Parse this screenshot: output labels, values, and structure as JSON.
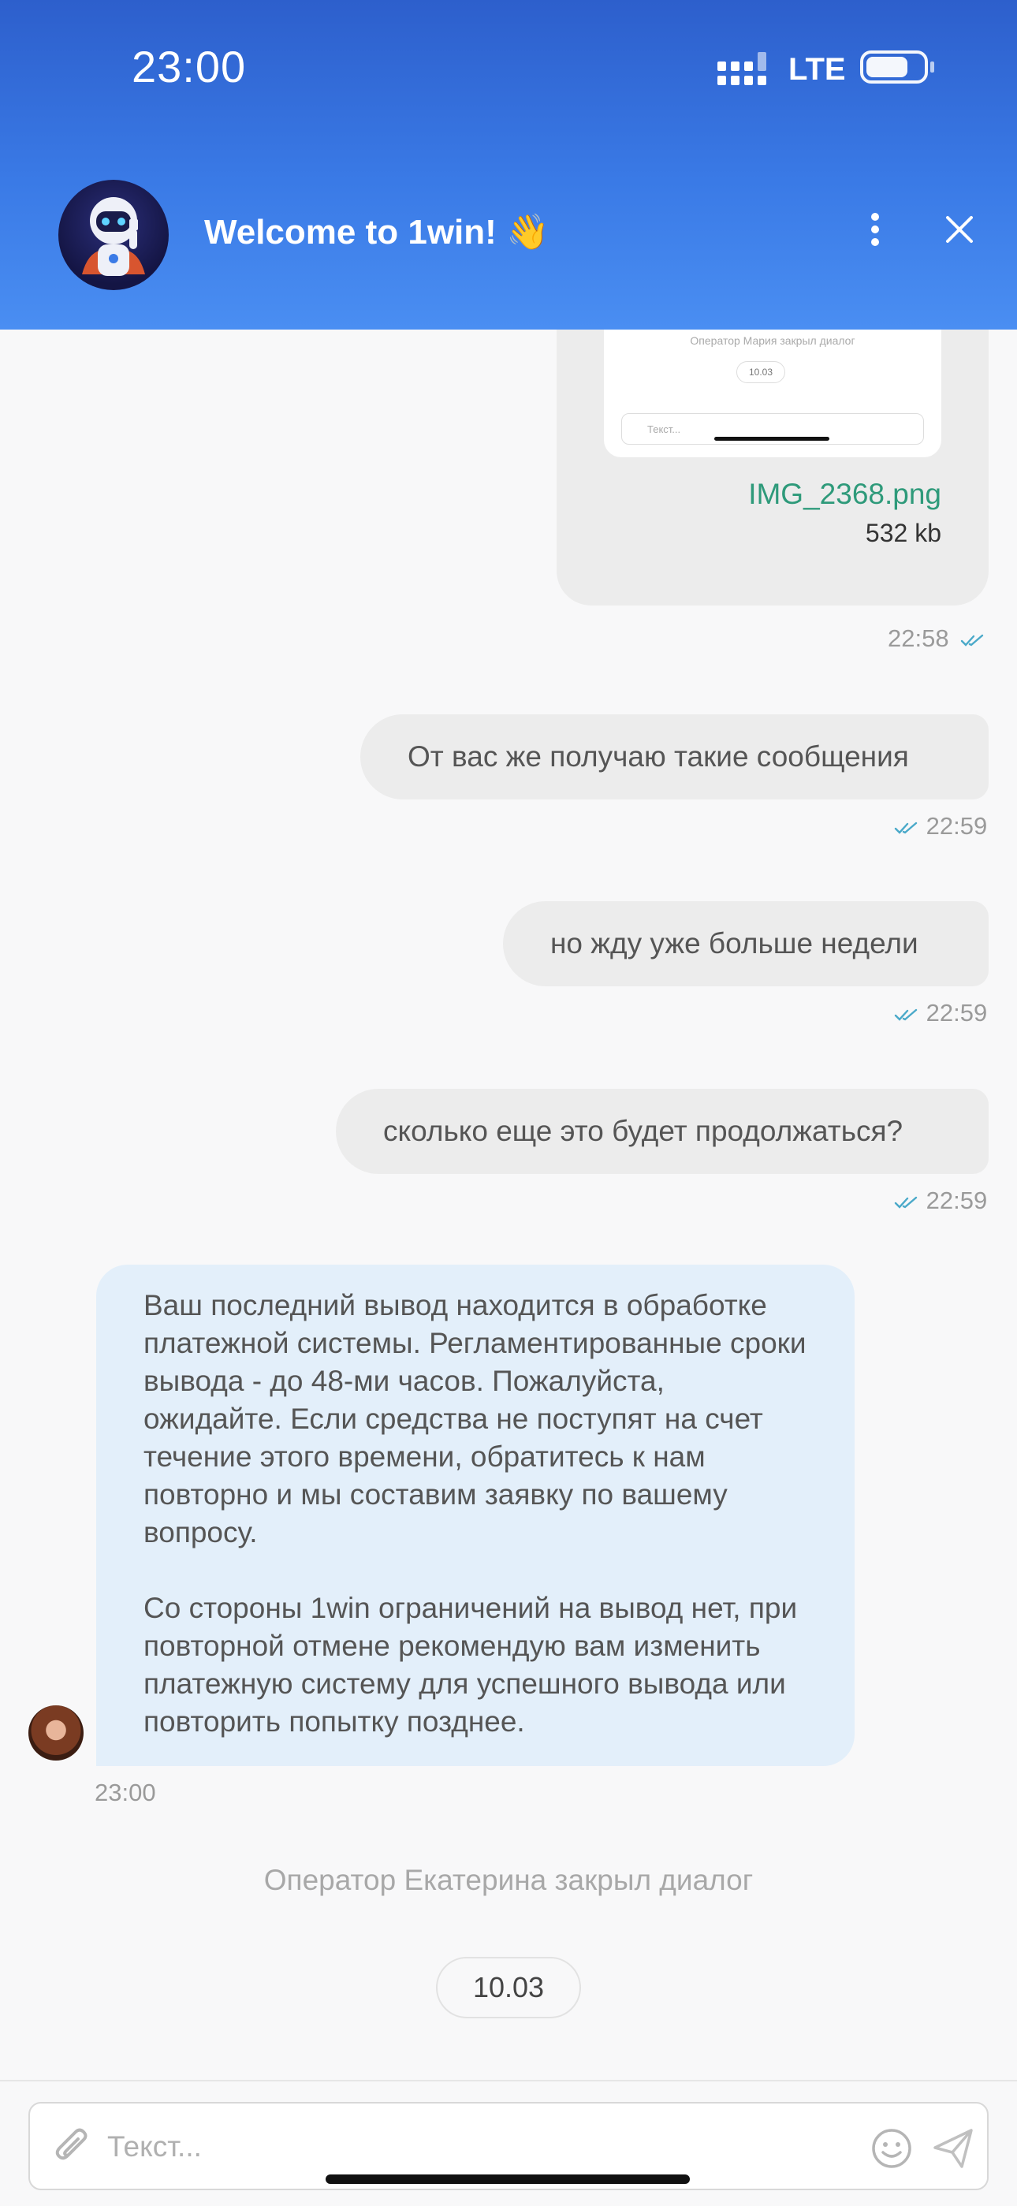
{
  "status_bar": {
    "time": "23:00",
    "network": "LTE"
  },
  "header": {
    "title": "Welcome to 1win! 👋"
  },
  "messages": {
    "image_file": {
      "thumb_caption": "Оператор Мария закрыл диалог",
      "thumb_date": "10.03",
      "thumb_placeholder": "Текст...",
      "file_name": "IMG_2368.png",
      "file_size": "532 kb",
      "time": "22:58"
    },
    "outgoing": [
      {
        "text": "От вас же получаю такие сообщения",
        "time": "22:59"
      },
      {
        "text": "но жду уже больше недели",
        "time": "22:59"
      },
      {
        "text": "сколько еще это будет продолжаться?",
        "time": "22:59"
      }
    ],
    "agent": {
      "paragraph1": "Ваш последний вывод находится в обработке платежной системы. Регламентированные сроки вывода - до 48-ми часов. Пожалуйста, ожидайте. Если средства не поступят на счет течение этого времени, обратитесь к нам повторно и мы составим заявку по вашему вопросу.",
      "paragraph2": "Со стороны 1win ограничений на вывод нет, при повторной отмене рекомендую вам изменить платежную систему для успешного вывода или повторить попытку позднее.",
      "time": "23:00"
    },
    "system": "Оператор Екатерина закрыл диалог",
    "date_divider": "10.03"
  },
  "composer": {
    "placeholder": "Текст..."
  },
  "colors": {
    "header_top": "#2d5fcc",
    "header_bottom": "#4a8ef2",
    "agent_bubble": "#e3effa",
    "outgoing_bubble": "#ececec",
    "file_link": "#2e9a7a",
    "read_check": "#4aa9c9"
  }
}
